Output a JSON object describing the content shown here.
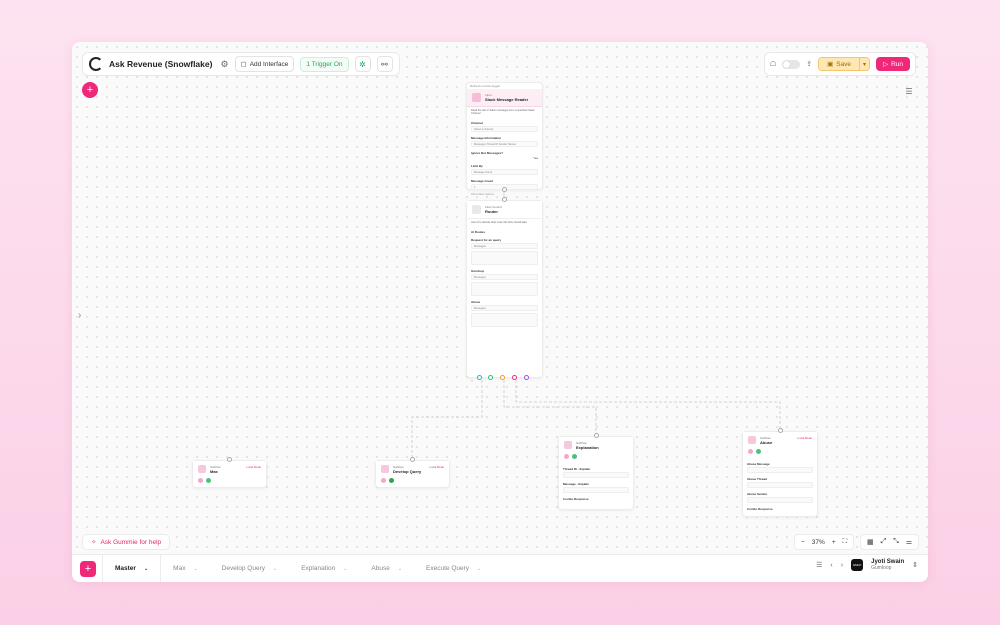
{
  "header": {
    "app_title": "Ask Revenue (Snowflake)",
    "add_interface": "Add Interface",
    "trigger_status": "1 Trigger On",
    "save_label": "Save",
    "run_label": "Run"
  },
  "nodes": {
    "slack_reader": {
      "top_note": "Refresh on flow trigger",
      "badge": "Input",
      "title": "Slack Message Reader",
      "description": "Read the last X Slack messages from a specified Slack Channel",
      "fields": [
        {
          "label": "Channel",
          "value": "Select a channel"
        },
        {
          "label": "Message Information",
          "value": "Messages  Thread ID  Sender Names"
        },
        {
          "label": "Ignore Bot Messages?",
          "value": "Yes"
        },
        {
          "label": "Limit By",
          "value": "Message Count"
        },
        {
          "label": "Message Count",
          "value": "1"
        }
      ],
      "footer": "Show More Options"
    },
    "router": {
      "badge": "Flow Control",
      "title": "Router",
      "description": "Use AI to decide what route this flow should take",
      "routes_label": "AI Routes",
      "routes": [
        {
          "name": "Request for an query",
          "type": "Messages"
        },
        {
          "name": "Gumloop",
          "type": "Messages"
        },
        {
          "name": "Abuse",
          "type": "Messages"
        }
      ]
    },
    "max": {
      "badge": "Subflow",
      "title": "Max",
      "tag": "Local Mode"
    },
    "develop_query": {
      "badge": "Subflow",
      "title": "Develop Query",
      "tag": "Local Mode"
    },
    "explanation": {
      "badge": "Subflow",
      "title": "Explanation",
      "fields": [
        "Thread ID - Explain",
        "Message - Explain",
        "Combo Response"
      ]
    },
    "abuse": {
      "badge": "Subflow",
      "title": "Abuse",
      "tag": "Local Mode",
      "fields": [
        "Abuse Message",
        "Abuse Thread",
        "Abuse Sender",
        "Combo Response"
      ]
    }
  },
  "canvas": {
    "help_label": "Ask Gummie for help",
    "zoom": "37%"
  },
  "tabs": [
    {
      "label": "Master",
      "active": true
    },
    {
      "label": "Max",
      "active": false
    },
    {
      "label": "Develop Query",
      "active": false
    },
    {
      "label": "Explanation",
      "active": false
    },
    {
      "label": "Abuse",
      "active": false
    },
    {
      "label": "Execute Query",
      "active": false
    }
  ],
  "user": {
    "name": "Jyoti Swain",
    "org": "Gumloop",
    "avatar_text": "GMLP"
  },
  "colors": {
    "accent": "#f0287a",
    "trigger_green": "#22a559",
    "save_bg": "#fde7b3"
  }
}
